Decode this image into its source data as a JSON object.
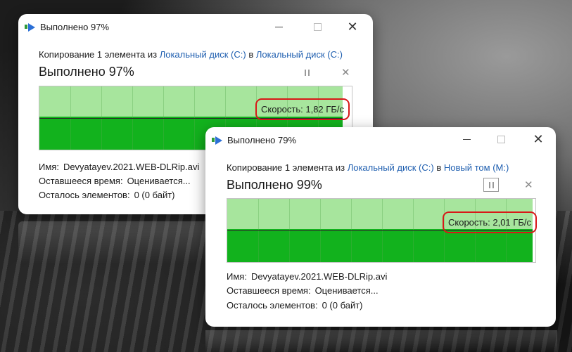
{
  "windows": [
    {
      "title": "Выполнено 97%",
      "copy_prefix": "Копирование 1 элемента из",
      "source": "Локальный диск (C:)",
      "copy_middle": "в",
      "destination": "Локальный диск (C:)",
      "status": "Выполнено 97%",
      "progress_percent": 97,
      "speed_label": "Скорость: 1,82 ГБ/с",
      "name_key": "Имя:",
      "name_value": "Devyatayev.2021.WEB-DLRip.avi",
      "time_key": "Оставшееся время:",
      "time_value": "Оценивается...",
      "items_key": "Осталось элементов:",
      "items_value": "0 (0 байт)"
    },
    {
      "title": "Выполнено 79%",
      "copy_prefix": "Копирование 1 элемента из",
      "source": "Локальный диск (C:)",
      "copy_middle": "в",
      "destination": "Новый том (M:)",
      "status": "Выполнено 99%",
      "progress_percent": 99,
      "speed_label": "Скорость: 2,01 ГБ/с",
      "name_key": "Имя:",
      "name_value": "Devyatayev.2021.WEB-DLRip.avi",
      "time_key": "Оставшееся время:",
      "time_value": "Оценивается...",
      "items_key": "Осталось элементов:",
      "items_value": "0 (0 байт)"
    }
  ],
  "colors": {
    "graph_light": "#a7e59d",
    "graph_dark": "#12b21d",
    "link": "#1f5fb0",
    "highlight": "#d81818"
  },
  "icons": [
    "copy-app-icon",
    "minimize-icon",
    "maximize-icon",
    "close-icon",
    "pause-icon",
    "cancel-icon"
  ]
}
